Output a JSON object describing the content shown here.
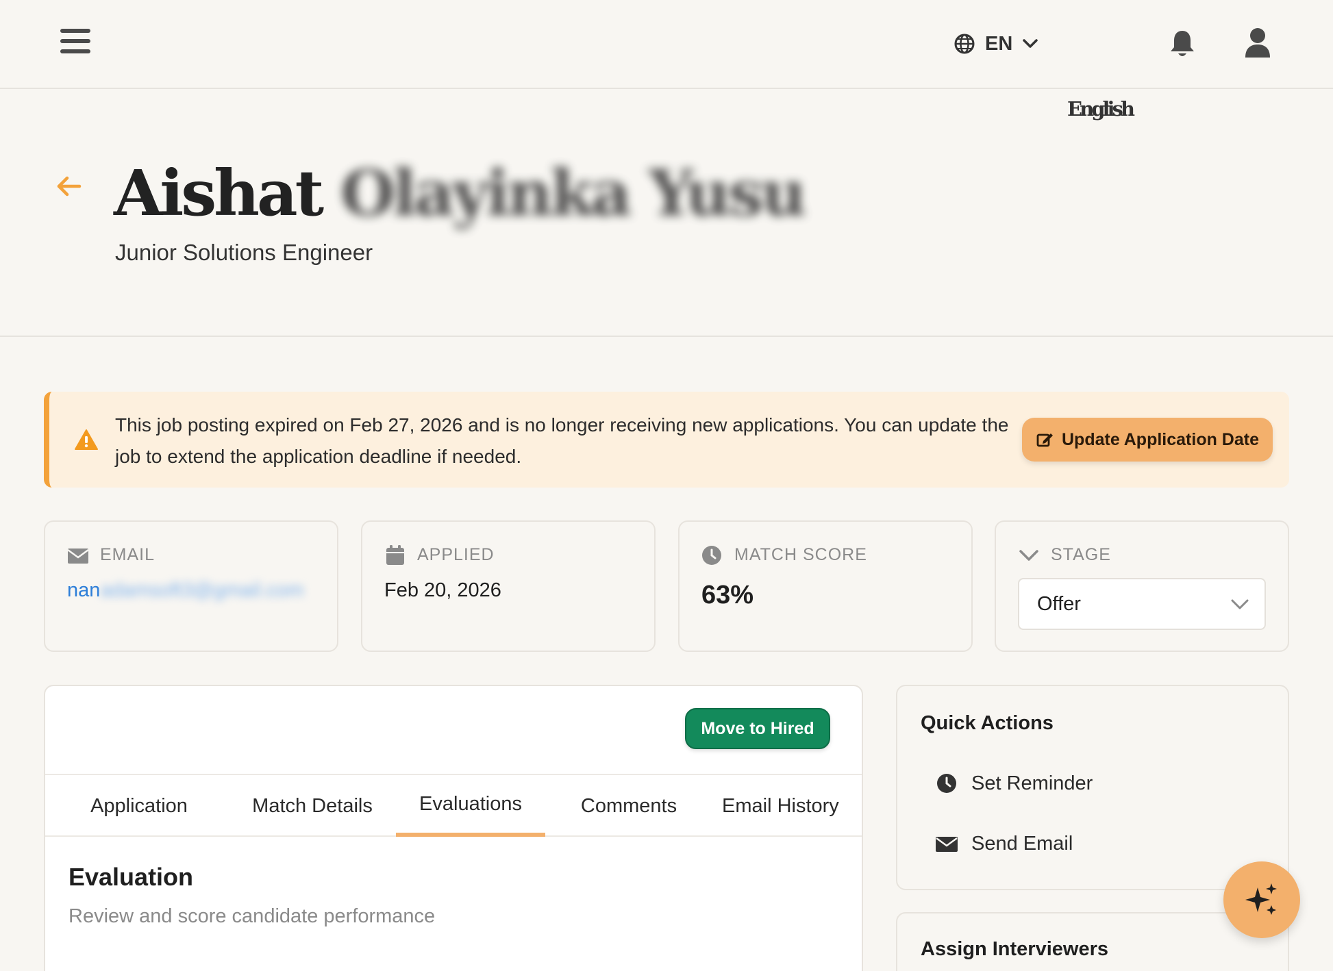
{
  "topbar": {
    "menu_icon": "hamburger-icon",
    "language_code": "EN",
    "language_name": "English",
    "language_icon": "globe-icon",
    "notification_icon": "bell-icon",
    "profile_icon": "user-icon"
  },
  "candidate": {
    "first_name": "Aishat",
    "last_name": "Olayinka Yusu",
    "job_title": "Junior Solutions Engineer"
  },
  "alert": {
    "message": "This job posting expired on Feb 27, 2026 and is no longer receiving new applications. You can update the job to extend the application deadline if needed.",
    "action_label": "Update Application Date",
    "accent_color": "#f3a23b"
  },
  "stats": {
    "email_label": "EMAIL",
    "email_value_visible": "nan",
    "email_value_obscured": "adamsoft3@gmail.com",
    "applied_label": "APPLIED",
    "applied_value": "Feb 20, 2026",
    "match_label": "MATCH SCORE",
    "match_value": "63%",
    "stage_label": "STAGE",
    "stage_value": "Offer"
  },
  "main": {
    "hired_button": "Move to Hired",
    "tabs": [
      {
        "label": "Application"
      },
      {
        "label": "Match Details"
      },
      {
        "label": "Evaluations"
      },
      {
        "label": "Comments"
      },
      {
        "label": "Email History"
      }
    ],
    "active_tab": "Evaluations",
    "section_title": "Evaluation",
    "section_subtitle": "Review and score candidate performance"
  },
  "quick_actions": {
    "title": "Quick Actions",
    "items": [
      {
        "label": "Set Reminder",
        "icon": "clock-icon"
      },
      {
        "label": "Send Email",
        "icon": "envelope-icon"
      }
    ]
  },
  "assign": {
    "title": "Assign Interviewers"
  },
  "colors": {
    "accent": "#f3b06c",
    "success": "#138a5b",
    "link": "#2d7ed8"
  }
}
